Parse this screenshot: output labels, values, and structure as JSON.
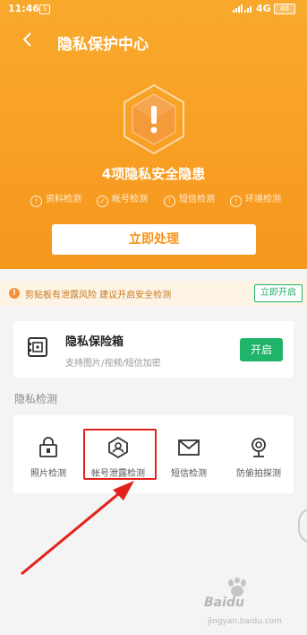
{
  "status_bar": {
    "time": "11:46",
    "notification_icon": "S",
    "network": "4G",
    "battery": "48"
  },
  "nav": {
    "back_icon": "chevron-left-icon",
    "title": "隐私保护中心"
  },
  "hero": {
    "issues_text": "4项隐私安全隐患",
    "checks": [
      {
        "label": "资料检测",
        "icon": "!"
      },
      {
        "label": "帐号检测",
        "icon": "✓"
      },
      {
        "label": "短信检测",
        "icon": "!"
      },
      {
        "label": "环境检测",
        "icon": "!"
      }
    ],
    "process_button": "立即处理"
  },
  "alert": {
    "icon": "!",
    "text": "剪贴板有泄露风险 建议开启安全检测",
    "button": "立即开启"
  },
  "vault": {
    "title": "隐私保险箱",
    "subtitle": "支持图片/视频/短信加密",
    "button": "开启"
  },
  "section": {
    "title": "隐私检测"
  },
  "detections": [
    {
      "label": "照片检测",
      "icon": "lock-photo-icon"
    },
    {
      "label": "帐号泄露检测",
      "icon": "user-shield-icon"
    },
    {
      "label": "短信检测",
      "icon": "envelope-icon"
    },
    {
      "label": "防偷拍探测",
      "icon": "camera-icon"
    }
  ],
  "colors": {
    "header": "#f7971d",
    "accent_green": "#20b36a",
    "highlight_red": "#e3221c"
  },
  "watermark": {
    "brand": "Baidu",
    "sub": "jingyan.baidu.com"
  }
}
